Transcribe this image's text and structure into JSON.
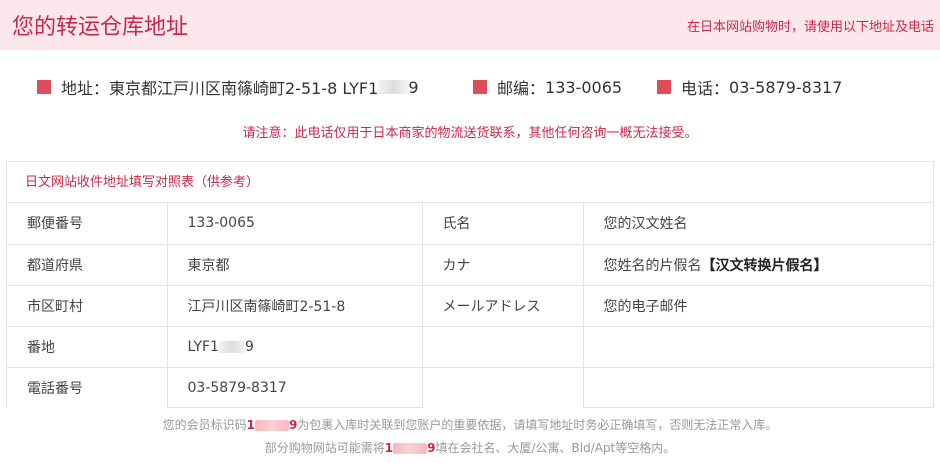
{
  "header": {
    "title": "您的转运仓库地址",
    "note": "在日本网站购物时，请使用以下地址及电话"
  },
  "info": {
    "address_label": "地址：",
    "address_value": "東京都江戸川区南篠崎町2-51-8 LYF1",
    "address_suffix": "9",
    "zip_label": "邮编：",
    "zip_value": "133-0065",
    "phone_label": "电话：",
    "phone_value": "03-5879-8317"
  },
  "notice": "请注意：此电话仅用于日本商家的物流送货联系，其他任何咨询一概无法接受。",
  "reference": {
    "title": "日文网站收件地址填写对照表（供参考）",
    "rows": [
      {
        "l1": "郵便番号",
        "v1": "133-0065",
        "l2": "氏名",
        "v2": "您的汉文姓名"
      },
      {
        "l1": "都道府県",
        "v1": "東京都",
        "l2": "カナ",
        "v2": "您姓名的片假名",
        "v2_bold": "【汉文转换片假名】"
      },
      {
        "l1": "市区町村",
        "v1": "江戸川区南篠崎町2-51-8",
        "l2": "メールアドレス",
        "v2": "您的电子邮件"
      },
      {
        "l1": "番地",
        "v1": "LYF1",
        "v1_suffix": "9",
        "l2": "",
        "v2": ""
      },
      {
        "l1": "電話番号",
        "v1": "03-5879-8317",
        "l2": "",
        "v2": ""
      }
    ]
  },
  "footer": {
    "line1_pre": "您的会员标识码",
    "line1_code_a": "1",
    "line1_code_b": "9",
    "line1_post": "为包裹入库时关联到您账户的重要依据，请填写地址时务必正确填写，否则无法正常入库。",
    "line2_pre": "部分购物网站可能需将",
    "line2_code_a": "1",
    "line2_code_b": "9",
    "line2_post": "填在会社名、大厦/公寓、Bld/Apt等空格内。"
  },
  "colors": {
    "accent": "#c8284a",
    "square": "#e04c5a",
    "header_bg": "#fce8ec"
  }
}
